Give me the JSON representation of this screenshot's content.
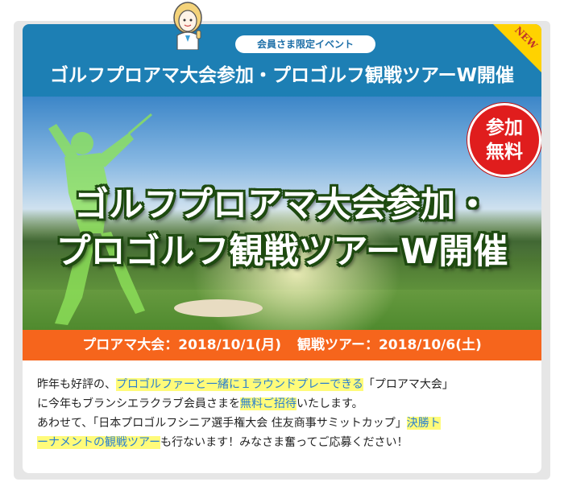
{
  "header": {
    "tag_label": "会員さま限定イベント",
    "title": "ゴルフプロアマ大会参加・プロゴルフ観戦ツアーW開催",
    "new_badge": "NEW"
  },
  "hero": {
    "title_line1": "ゴルフプロアマ大会参加・",
    "title_line2": "プロゴルフ観戦ツアーW開催",
    "badge_line1": "参加",
    "badge_line2": "無料"
  },
  "dates": {
    "proam": "プロアマ大会：2018/10/1(月)",
    "tour": "観戦ツアー：2018/10/6(土)"
  },
  "body": {
    "p1_a": "昨年も好評の、",
    "p1_hl": "プロゴルファーと一緒に１ラウンドプレーできる",
    "p1_b": "「プロアマ大会」",
    "p2_a": "に今年もブランシエラクラブ会員さまを",
    "p2_hl": "無料ご招待",
    "p2_b": "いたします。",
    "p3_a": "あわせて、「日本プロゴルフシニア選手権大会 住友商事サミットカップ」",
    "p3_hl1": "決勝ト",
    "p4_hl2": "ーナメントの観戦ツアー",
    "p4_b": "も行ないます！みなさま奮ってご応募ください！"
  },
  "colors": {
    "header_blue": "#1d7fb4",
    "date_orange": "#f6651c",
    "badge_red": "#e01d1d",
    "highlight_yellow": "#fffb7a",
    "highlight_text_blue": "#2a7fd0",
    "new_ribbon_yellow": "#ffd200"
  },
  "icons": {
    "mascot": "mascot-woman-icon",
    "golfer": "golfer-silhouette-icon"
  }
}
